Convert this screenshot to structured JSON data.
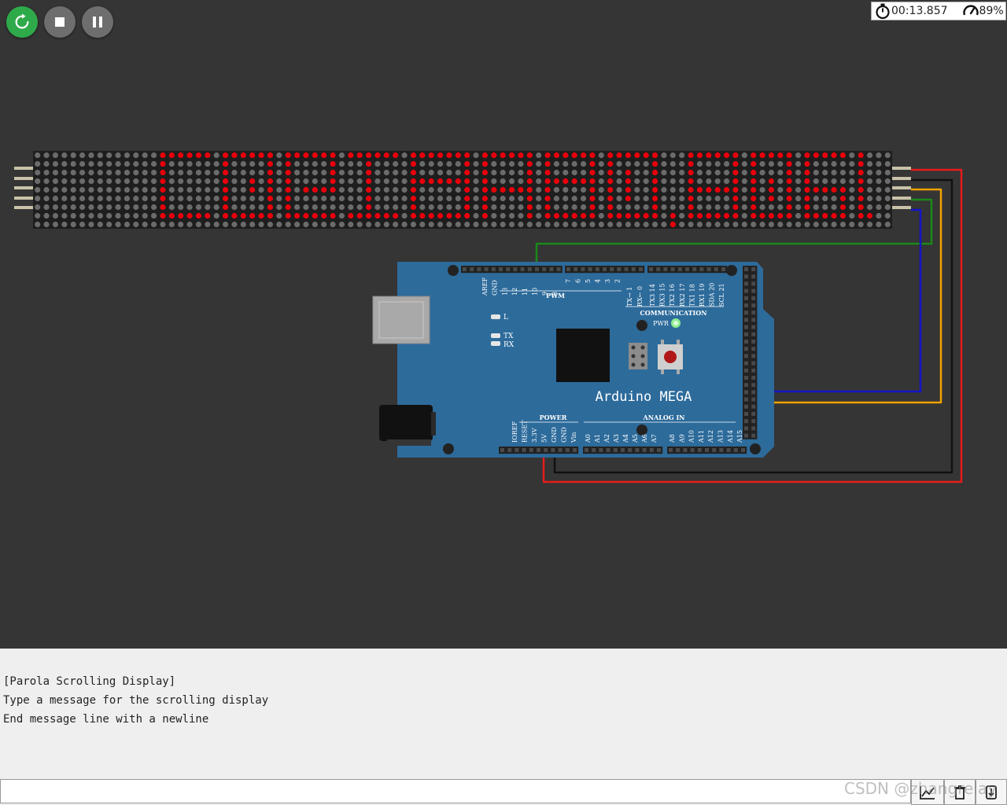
{
  "toolbar": {
    "restart_label": "Restart simulation",
    "stop_label": "Stop simulation",
    "pause_label": "Pause simulation"
  },
  "stats": {
    "time": "00:13.857",
    "speed": "89%"
  },
  "board": {
    "title": "Arduino MEGA",
    "pwm": "PWM",
    "communication": "COMMUNICATION",
    "power": "POWER",
    "analog_in": "ANALOG IN",
    "pwr_led": "PWR",
    "led_l": "L",
    "led_tx": "TX",
    "led_rx": "RX",
    "top_pins_a": [
      "AREF",
      "GND",
      "13",
      "12",
      "11",
      "10",
      "9",
      "8"
    ],
    "top_pins_b": [
      "7",
      "6",
      "5",
      "4",
      "3",
      "2",
      "1",
      "0"
    ],
    "top_pins_c": [
      "TX3 14",
      "RX3 15",
      "TX2 16",
      "RX2 17",
      "TX1 18",
      "RX1 19",
      "SDA 20",
      "SCL 21"
    ],
    "tx_label": "TX→ 1",
    "rx_label": "RX← 0",
    "power_pins": [
      "IOREF",
      "RESET",
      "3.3V",
      "5V",
      "GND",
      "GND",
      "Vin"
    ],
    "analog_pins_a": [
      "A0",
      "A1",
      "A2",
      "A3",
      "A4",
      "A5",
      "A6",
      "A7"
    ],
    "analog_pins_b": [
      "A8",
      "A9",
      "A10",
      "A11",
      "A12",
      "A13",
      "A14",
      "A15"
    ]
  },
  "matrix": {
    "rows": 8,
    "columns": 96,
    "lit_color": "#e8000b",
    "off_color": "#6b6b6b",
    "background": "#1e1e1e"
  },
  "wires": {
    "vcc": "#e51c1c",
    "gnd": "#111111",
    "din": "#1414c8",
    "cs": "#f0a000",
    "clk": "#1a8a1a"
  },
  "serial": {
    "lines": [
      "[Parola Scrolling Display]",
      "Type a message for the scrolling display",
      "End message line with a newline"
    ],
    "input_value": "",
    "input_placeholder": ""
  },
  "watermark": "CSDN @zhangrelay",
  "accent": "#2faa4a"
}
